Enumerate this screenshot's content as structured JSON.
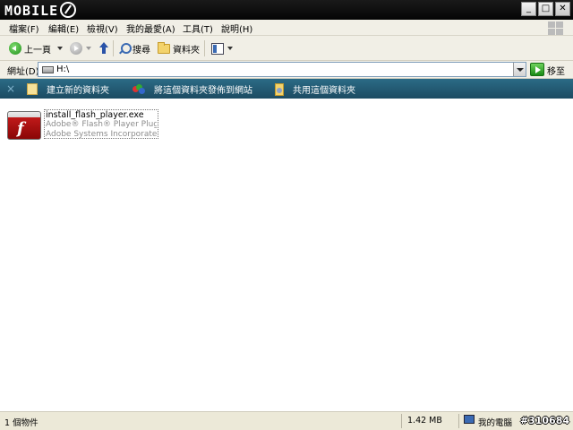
{
  "window": {
    "logo_text": "MOBILE",
    "buttons": {
      "minimize": "_",
      "maximize": "□",
      "close": "✕"
    }
  },
  "menu": [
    "檔案(F)",
    "編輯(E)",
    "檢視(V)",
    "我的最愛(A)",
    "工具(T)",
    "說明(H)"
  ],
  "toolbar": {
    "back_label": "上一頁",
    "search_label": "搜尋",
    "folders_label": "資料夾"
  },
  "address": {
    "label": "網址(D)",
    "value": "H:\\",
    "go_label": "移至"
  },
  "tasks": {
    "close_glyph": "×",
    "items": [
      "建立新的資料夾",
      "將這個資料夾發佈到網站",
      "共用這個資料夾"
    ]
  },
  "file": {
    "icon_letter": "f",
    "name": "install_flash_player.exe",
    "description": "Adobe® Flash® Player Plugin ...",
    "company": "Adobe Systems Incorporated"
  },
  "status": {
    "count": "1 個物件",
    "size": "1.42 MB",
    "location": "我的電腦",
    "watermark": "#310684"
  },
  "colors": {
    "titlebar": "#0a0a0a",
    "task_strip": "#245d78",
    "chrome": "#f1efe6"
  }
}
